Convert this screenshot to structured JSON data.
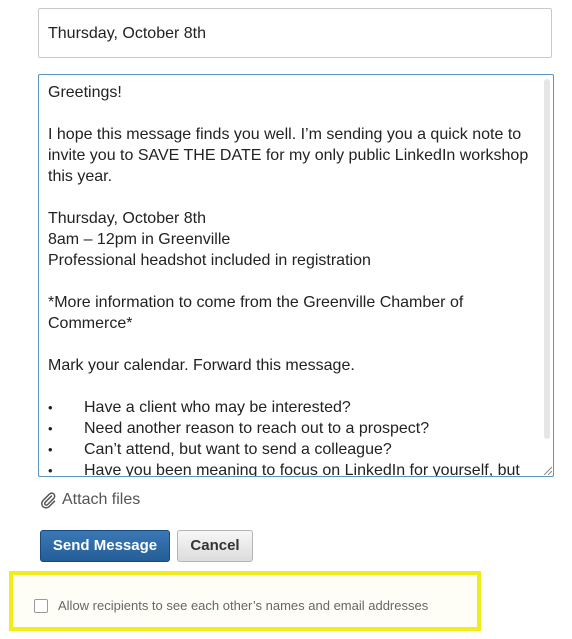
{
  "subject": {
    "value": "Thursday, October 8th"
  },
  "message": {
    "greeting": "Greetings!",
    "intro": "I hope this message finds you well. I’m sending you a quick note to invite you to SAVE THE DATE for my only public LinkedIn workshop this year.",
    "event_date": "Thursday, October 8th",
    "event_time": "8am – 12pm in Greenville",
    "event_note": "Professional headshot included in registration",
    "more_info": "*More information to come from the Greenville Chamber of Commerce*",
    "call_to_action": "Mark your calendar. Forward this message.",
    "bullet_char": "•",
    "bullets": [
      "Have a client who may be interested?",
      "Need another reason to reach out to a prospect?",
      "Can’t attend, but want to send a colleague?",
      "Have you been meaning to focus on LinkedIn for yourself, but"
    ]
  },
  "attach": {
    "label": "Attach files",
    "icon": "paperclip-icon"
  },
  "actions": {
    "send_label": "Send Message",
    "cancel_label": "Cancel"
  },
  "options": {
    "allow_recipients_label": "Allow recipients to see each other’s names and email addresses",
    "allow_recipients_checked": false
  },
  "colors": {
    "send_button": "#245e98",
    "textarea_focus_border": "#5a93c4",
    "highlight_border": "#f2ec1d"
  }
}
